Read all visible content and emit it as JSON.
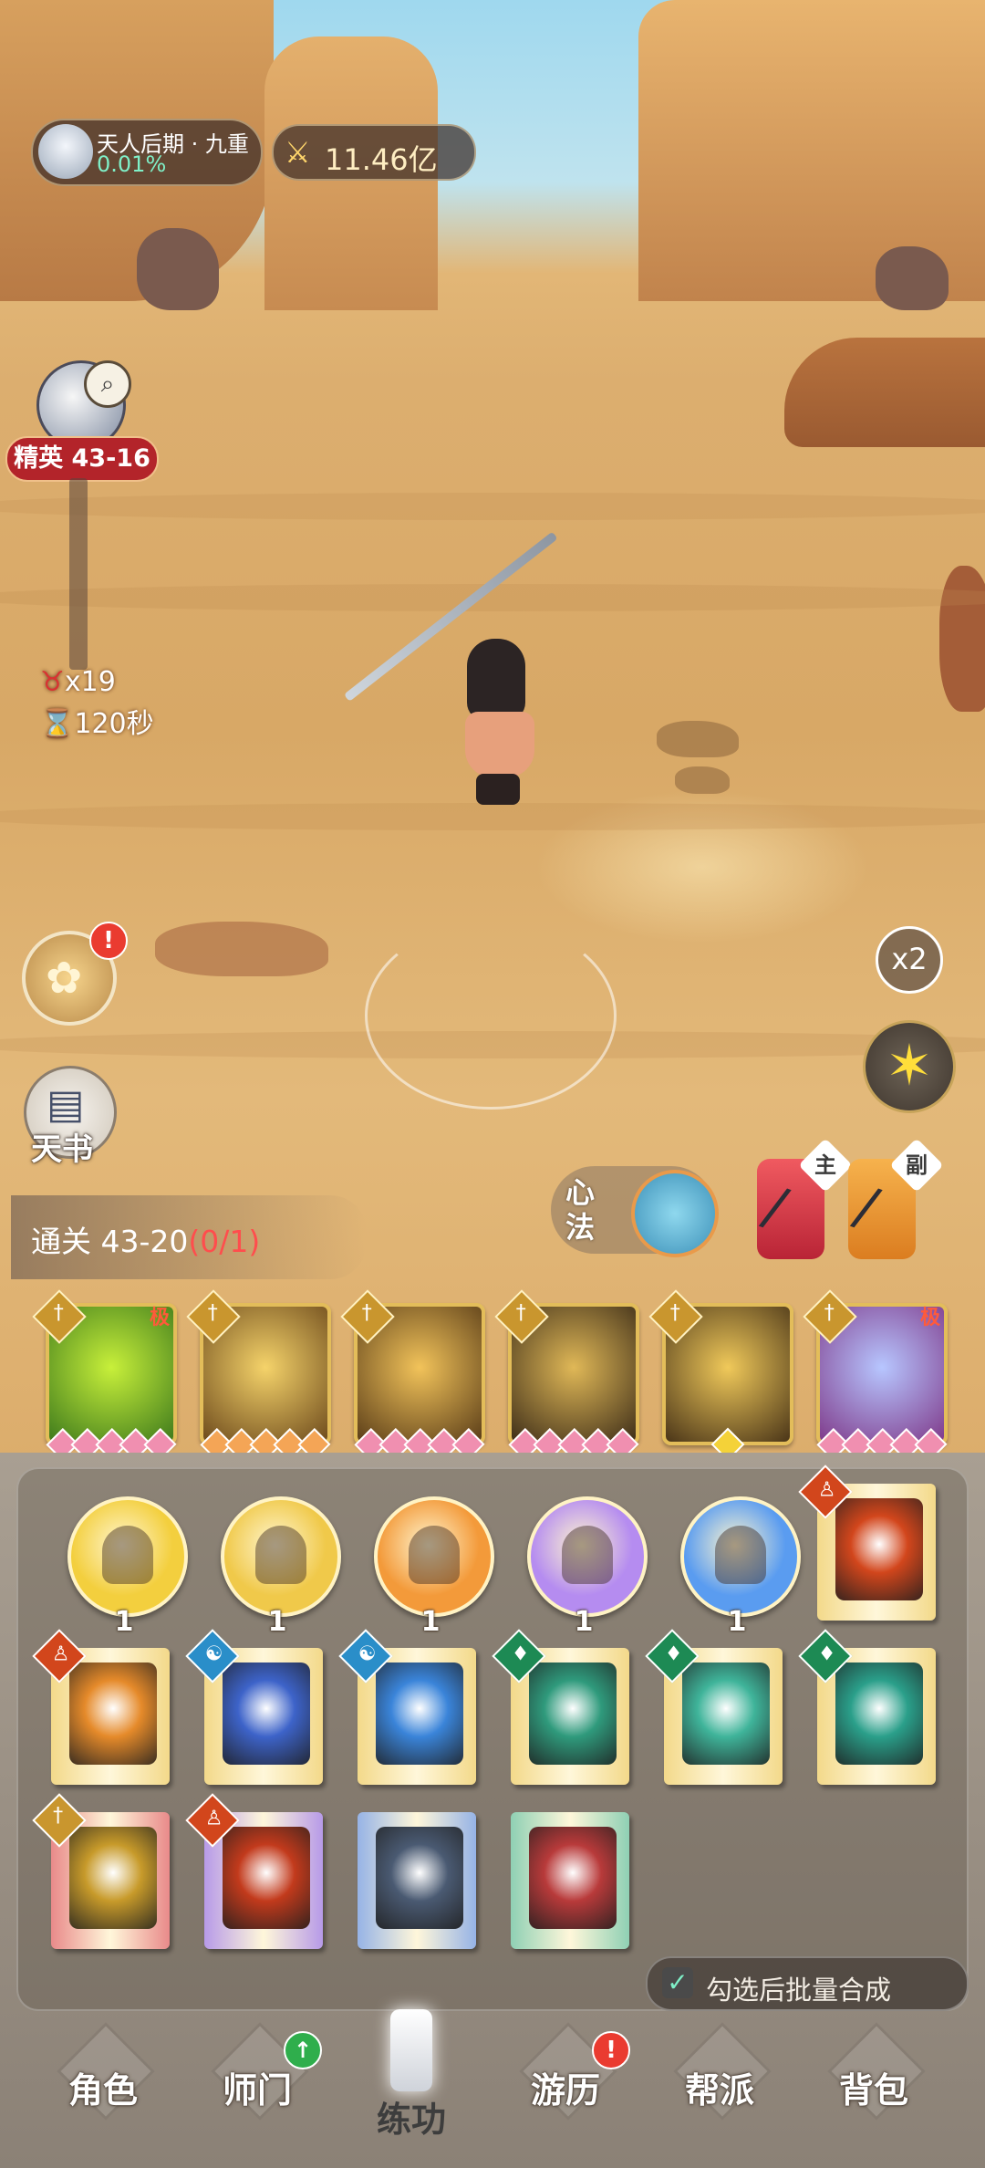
{
  "hud": {
    "realm_title": "天人后期 · 九重",
    "realm_percent": "0.01%",
    "power_value": "11.46亿",
    "power_icon": "crossed-swords-icon"
  },
  "stage": {
    "badge": "精英 43-16",
    "kills": "x19",
    "time": "120秒"
  },
  "left_buttons": {
    "book_label": "天书",
    "bag_alert": "!"
  },
  "right_buttons": {
    "speed": "x2",
    "star_icon": "star-icon"
  },
  "progress": {
    "label": "通关 43-20",
    "count": "(0/1)"
  },
  "xinfa": {
    "label": "心法"
  },
  "weapons": {
    "main_tag": "主",
    "sub_tag": "副"
  },
  "equipped_skills": [
    {
      "grade": "极",
      "colors": [
        "#c8f03a",
        "#3e7a1c"
      ],
      "gems": "pink"
    },
    {
      "grade": "",
      "colors": [
        "#f5d36a",
        "#6d4a1c"
      ],
      "gems": "orange"
    },
    {
      "grade": "",
      "colors": [
        "#f2c35a",
        "#5a3d18"
      ],
      "gems": "pink"
    },
    {
      "grade": "",
      "colors": [
        "#e0b857",
        "#3d2d18"
      ],
      "gems": "pink"
    },
    {
      "grade": "",
      "colors": [
        "#f0c95a",
        "#4a3518"
      ],
      "gems": "yellow"
    },
    {
      "grade": "极",
      "colors": [
        "#b7c6ff",
        "#7f3a8a"
      ],
      "gems": "pink"
    }
  ],
  "orbs": [
    {
      "count": "1",
      "color": "#f3cf3e"
    },
    {
      "count": "1",
      "color": "#f0c94a"
    },
    {
      "count": "1",
      "color": "#f39a3a"
    },
    {
      "count": "1",
      "color": "#b58cf0"
    },
    {
      "count": "1",
      "color": "#5a9cf0"
    }
  ],
  "books": [
    {
      "cover": "#f3d98a",
      "art": "#d2461c",
      "mark": "#d2461c",
      "mark_icon": "person-icon"
    },
    {
      "cover": "#f3d98a",
      "art": "#e58a2a",
      "mark": "#d2461c",
      "mark_icon": "person-icon"
    },
    {
      "cover": "#f3d98a",
      "art": "#3d63c9",
      "mark": "#2a8ec9",
      "mark_icon": "yin-yang-icon"
    },
    {
      "cover": "#f3d98a",
      "art": "#3a84d9",
      "mark": "#2a8ec9",
      "mark_icon": "yin-yang-icon"
    },
    {
      "cover": "#f3d98a",
      "art": "#2f9a7c",
      "mark": "#1d8a54",
      "mark_icon": "dagger-icon"
    },
    {
      "cover": "#f3d98a",
      "art": "#3fb49a",
      "mark": "#1d8a54",
      "mark_icon": "dagger-icon"
    },
    {
      "cover": "#f3d98a",
      "art": "#2a9f8a",
      "mark": "#1d8a54",
      "mark_icon": "dagger-icon"
    },
    {
      "cover": "#e98a8a",
      "art": "#c79a2a",
      "mark": "#c9962e",
      "mark_icon": "sword-icon"
    },
    {
      "cover": "#b79ae8",
      "art": "#c23a1c",
      "mark": "#d2461c",
      "mark_icon": "person-icon"
    },
    {
      "cover": "#96b3e6",
      "art": "#4a5a72",
      "mark": "",
      "mark_icon": ""
    },
    {
      "cover": "#8fd0b4",
      "art": "#b83a3a",
      "mark": "",
      "mark_icon": ""
    }
  ],
  "batch": {
    "label": "勾选后批量合成",
    "checked": true
  },
  "nav": [
    {
      "label": "角色",
      "badge": ""
    },
    {
      "label": "师门",
      "badge": "up"
    },
    {
      "label": "练功",
      "badge": "",
      "active": true
    },
    {
      "label": "游历",
      "badge": "alert"
    },
    {
      "label": "帮派",
      "badge": ""
    },
    {
      "label": "背包",
      "badge": ""
    }
  ]
}
